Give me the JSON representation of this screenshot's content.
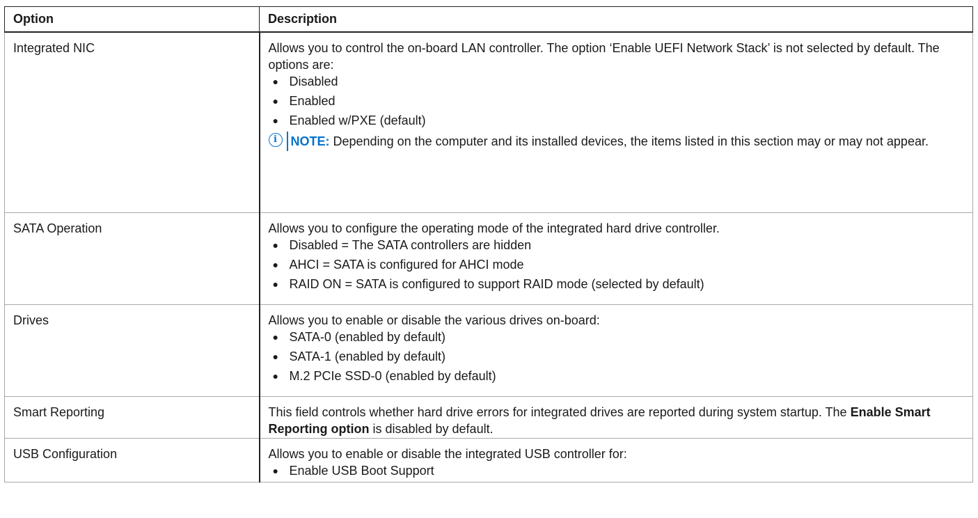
{
  "headers": {
    "option": "Option",
    "description": "Description"
  },
  "rows": {
    "nic": {
      "option": "Integrated NIC",
      "desc": "Allows you to control the on-board LAN controller. The option ‘Enable UEFI Network Stack’ is not selected by default. The options are:",
      "items": [
        "Disabled",
        "Enabled",
        "Enabled w/PXE (default)"
      ],
      "note_label": "NOTE:",
      "note_text": " Depending on the computer and its installed devices, the items listed in this section may or may not appear."
    },
    "sata": {
      "option": "SATA Operation",
      "desc": "Allows you to configure the operating mode of the integrated hard drive controller.",
      "items": [
        "Disabled = The SATA controllers are hidden",
        "AHCI = SATA is configured for AHCI mode",
        "RAID ON = SATA is configured to support RAID mode (selected by default)"
      ]
    },
    "drives": {
      "option": "Drives",
      "desc": "Allows you to enable or disable the various drives on-board:",
      "items": [
        "SATA-0 (enabled by default)",
        "SATA-1 (enabled by default)",
        "M.2 PCIe SSD-0 (enabled by default)"
      ]
    },
    "smart": {
      "option": "Smart Reporting",
      "desc_a": "This field controls whether hard drive errors for integrated drives are reported during system startup. The ",
      "desc_bold": "Enable Smart Reporting option",
      "desc_b": " is disabled by default."
    },
    "usb": {
      "option": "USB Configuration",
      "desc": "Allows you to enable or disable the integrated USB controller for:",
      "items": [
        "Enable USB Boot Support"
      ]
    }
  },
  "bullet_glyph": "●"
}
